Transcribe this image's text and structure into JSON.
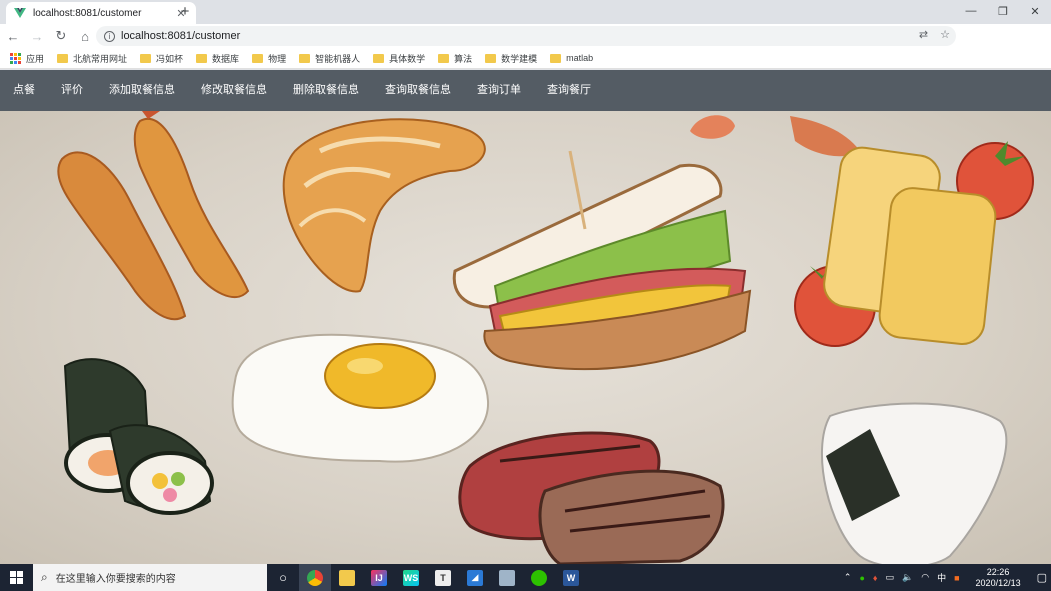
{
  "browser": {
    "tab_title": "localhost:8081/customer",
    "url": "localhost:8081/customer",
    "new_tab_label": "+",
    "bookmarks": [
      {
        "label": "应用",
        "icon": "apps-grid-icon"
      },
      {
        "label": "北航常用网址",
        "icon": "folder-icon"
      },
      {
        "label": "冯如杯",
        "icon": "folder-icon"
      },
      {
        "label": "数据库",
        "icon": "folder-icon"
      },
      {
        "label": "物理",
        "icon": "folder-icon"
      },
      {
        "label": "智能机器人",
        "icon": "folder-icon"
      },
      {
        "label": "具体数学",
        "icon": "folder-icon"
      },
      {
        "label": "算法",
        "icon": "folder-icon"
      },
      {
        "label": "数学建模",
        "icon": "folder-icon"
      },
      {
        "label": "matlab",
        "icon": "folder-icon"
      }
    ]
  },
  "nav": {
    "items": [
      {
        "label": "点餐"
      },
      {
        "label": "评价"
      },
      {
        "label": "添加取餐信息"
      },
      {
        "label": "修改取餐信息"
      },
      {
        "label": "删除取餐信息"
      },
      {
        "label": "查询取餐信息"
      },
      {
        "label": "查询订单"
      },
      {
        "label": "查询餐厅"
      }
    ],
    "background": "#545c64",
    "text_color": "#ffffff"
  },
  "hero": {
    "foods": [
      "fried-shrimp",
      "croissant",
      "sandwich",
      "tamagoyaki",
      "tomato",
      "sushi-roll",
      "fried-egg",
      "steak",
      "onigiri"
    ]
  },
  "taskbar": {
    "search_placeholder": "在这里输入你要搜索的内容",
    "time": "22:26",
    "date": "2020/12/13",
    "apps": [
      "cortana",
      "chrome",
      "file-explorer",
      "intellij",
      "webstorm",
      "typora",
      "vscode",
      "photos",
      "wechat",
      "word"
    ]
  }
}
